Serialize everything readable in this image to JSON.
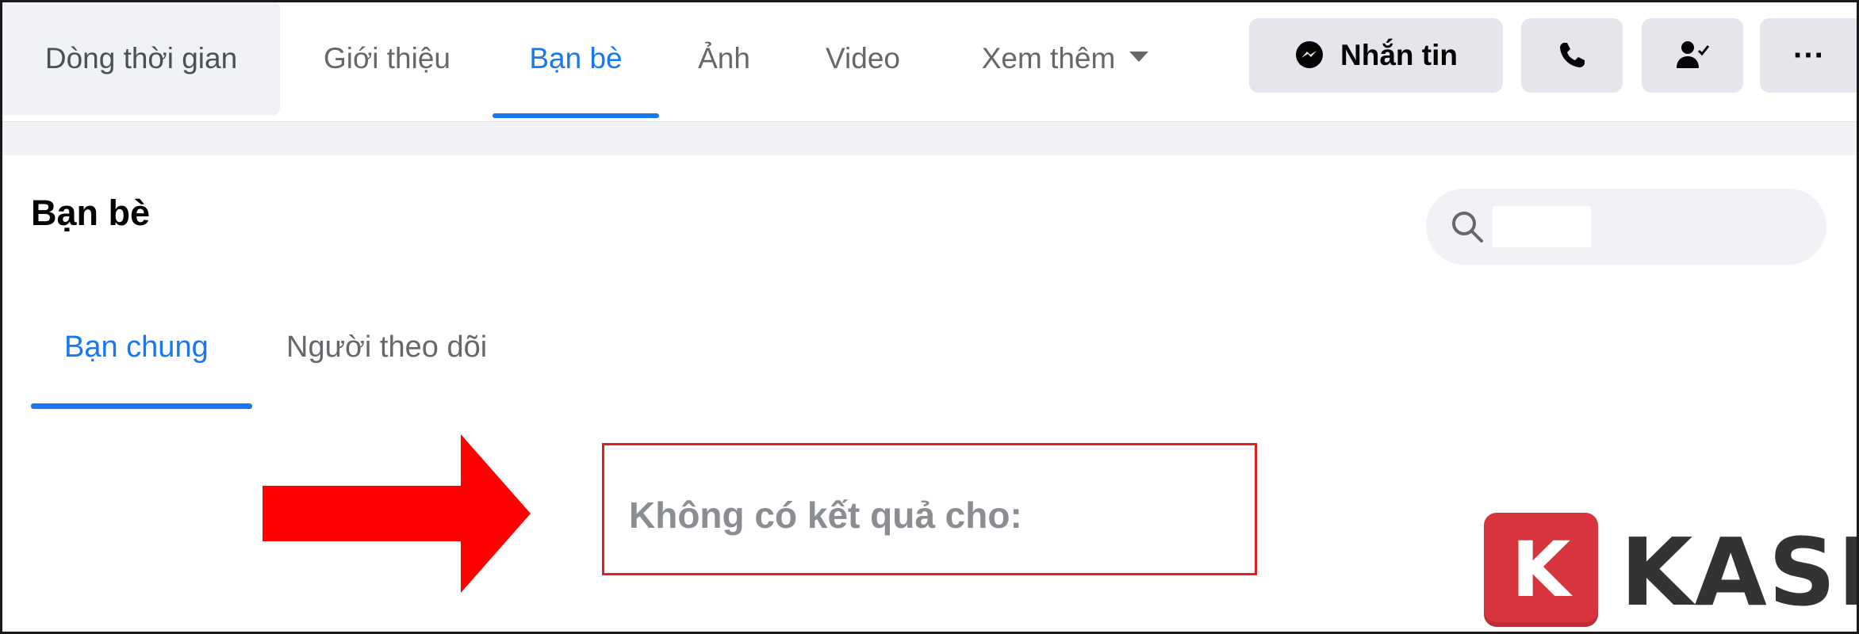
{
  "profile_tabs": [
    {
      "label": "Dòng thời gian"
    },
    {
      "label": "Giới thiệu"
    },
    {
      "label": "Bạn bè"
    },
    {
      "label": "Ảnh"
    },
    {
      "label": "Video"
    },
    {
      "label": "Xem thêm"
    }
  ],
  "actions": {
    "message_label": "Nhắn tin",
    "message_icon": "messenger-icon",
    "call_icon": "phone-icon",
    "friend_icon": "friend-status-icon",
    "more_icon": "ellipsis-icon",
    "more_glyph": "···"
  },
  "friends": {
    "title": "Bạn bè",
    "search": {
      "value": "",
      "icon": "search-icon"
    },
    "subtabs": [
      {
        "label": "Bạn chung"
      },
      {
        "label": "Người theo dõi"
      }
    ],
    "empty_result": "Không có kết quả cho:"
  },
  "annotation": {
    "arrow_color": "#ff0000",
    "box_color": "#e02020"
  },
  "watermark": {
    "badge_letter": "K",
    "brand": "KASHI",
    "badge_color": "#d8343d"
  },
  "colors": {
    "accent": "#1877f2",
    "button_bg": "#e4e6eb",
    "muted_text": "#65676b"
  }
}
